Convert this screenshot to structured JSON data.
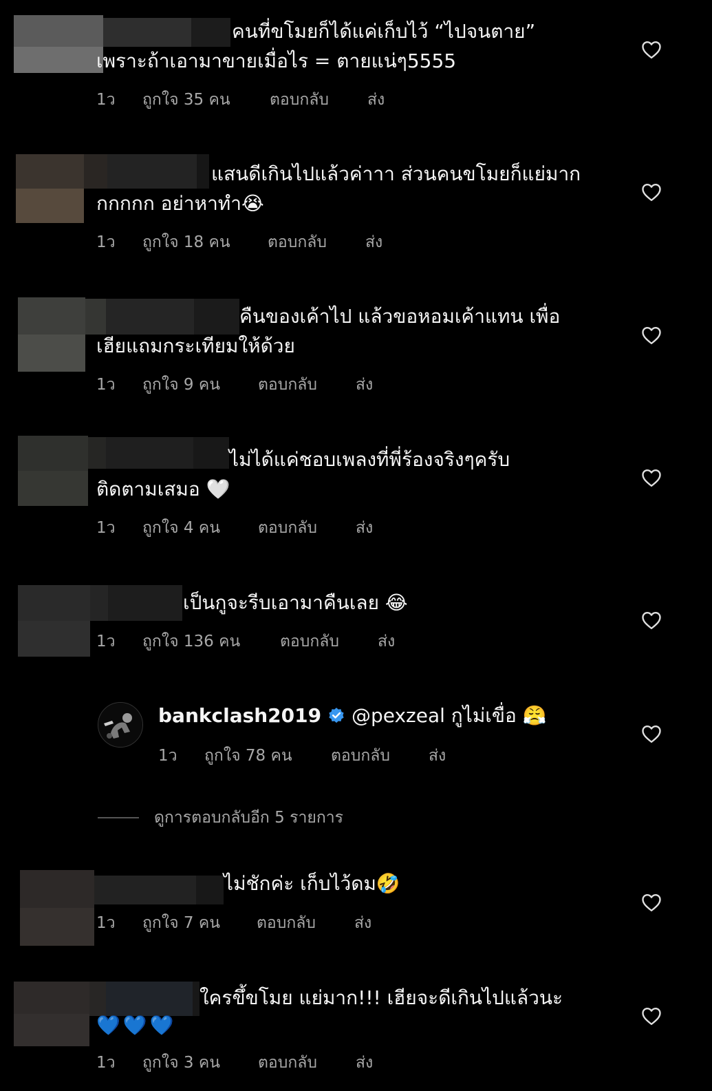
{
  "comments": [
    {
      "line1": "คนที่ขโมยก็ได้แค่เก็บไว้ “ไปจนตาย”",
      "line2": "เพราะถ้าเอามาขายเมื่อไร = ตายแน่ๆ5555",
      "time": "1ว",
      "likes": "ถูกใจ 35 คน",
      "reply": "ตอบกลับ",
      "send": "ส่ง"
    },
    {
      "line1": "แสนดีเกินไปแล้วค่าาา ส่วนคนขโมยก็แย่มาก",
      "line2": "กกกกก อย่าหาทำ😭",
      "time": "1ว",
      "likes": "ถูกใจ 18 คน",
      "reply": "ตอบกลับ",
      "send": "ส่ง"
    },
    {
      "line1": "คืนของเค้าไป แล้วขอหอมเค้าแทน เพื่อ",
      "line2": "เฮียแถมกระเทียมให้ด้วย",
      "time": "1ว",
      "likes": "ถูกใจ 9 คน",
      "reply": "ตอบกลับ",
      "send": "ส่ง"
    },
    {
      "line1": "ไม่ได้แค่ชอบเพลงที่พี่ร้องจริงๆครับ",
      "line2": "ติดตามเสมอ 🤍",
      "time": "1ว",
      "likes": "ถูกใจ 4 คน",
      "reply": "ตอบกลับ",
      "send": "ส่ง"
    },
    {
      "line1": "เป็นกูจะรีบเอามาคืนเลย 😂",
      "time": "1ว",
      "likes": "ถูกใจ 136 คน",
      "reply": "ตอบกลับ",
      "send": "ส่ง"
    }
  ],
  "reply_comment": {
    "username": "bankclash2019",
    "mention": "@pexzeal",
    "text": "กูไม่เขื่อ 😤",
    "time": "1ว",
    "likes": "ถูกใจ 78 คน",
    "reply": "ตอบกลับ",
    "send": "ส่ง"
  },
  "view_replies": "ดูการตอบกลับอีก 5 รายการ",
  "comments_after": [
    {
      "line1": "ไม่ชักค่ะ เก็บไว้ดม🤣",
      "time": "1ว",
      "likes": "ถูกใจ 7 คน",
      "reply": "ตอบกลับ",
      "send": "ส่ง"
    },
    {
      "line1": "ใครขึ้ขโมย แย่มาก!!! เฮียจะดีเกินไปแล้วนะ",
      "line2": "💙💙💙",
      "time": "1ว",
      "likes": "ถูกใจ 3 คน",
      "reply": "ตอบกลับ",
      "send": "ส่ง"
    }
  ],
  "colors": {
    "background": "#000000",
    "text": "#f5f5f5",
    "meta": "#a8a8a8",
    "verified": "#3897f0"
  }
}
